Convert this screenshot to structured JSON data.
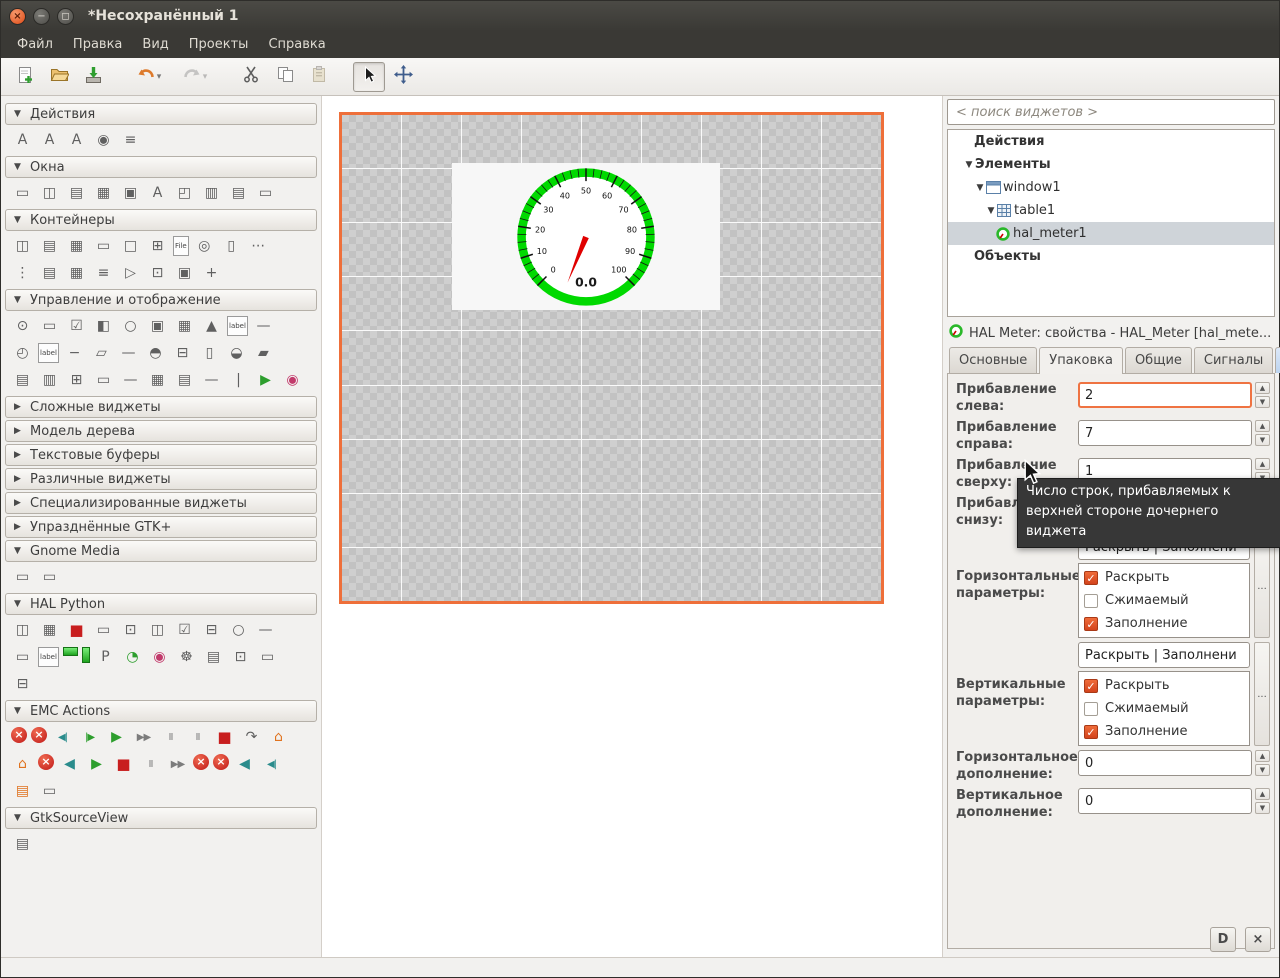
{
  "window": {
    "title": "*Несохранённый 1",
    "controls": [
      "close-button",
      "minimize-button",
      "maximize-button"
    ]
  },
  "menubar": [
    "Файл",
    "Правка",
    "Вид",
    "Проекты",
    "Справка"
  ],
  "toolbar": {
    "icons": [
      "new-file-icon",
      "open-folder-icon",
      "save-icon",
      "undo-icon",
      "redo-icon",
      "cut-icon",
      "copy-icon",
      "paste-icon",
      "pointer-icon",
      "move-resize-icon"
    ]
  },
  "palette": {
    "sections": [
      {
        "label": "Действия",
        "expanded": true,
        "rows": [
          [
            {
              "g": "A",
              "c": ""
            },
            {
              "g": "A",
              "c": ""
            },
            {
              "g": "A",
              "c": ""
            },
            {
              "g": "◉",
              "c": ""
            },
            {
              "g": "≡",
              "c": ""
            }
          ]
        ]
      },
      {
        "label": "Окна",
        "expanded": true,
        "rows": [
          [
            {
              "g": "▭",
              "c": ""
            },
            {
              "g": "◫",
              "c": ""
            },
            {
              "g": "▤",
              "c": ""
            },
            {
              "g": "▦",
              "c": ""
            },
            {
              "g": "▣",
              "c": ""
            },
            {
              "g": "A",
              "c": ""
            },
            {
              "g": "◰",
              "c": ""
            },
            {
              "g": "▥",
              "c": ""
            },
            {
              "g": "▤",
              "c": ""
            },
            {
              "g": "▭",
              "c": ""
            }
          ]
        ]
      },
      {
        "label": "Контейнеры",
        "expanded": true,
        "rows": [
          [
            {
              "g": "◫",
              "c": ""
            },
            {
              "g": "▤",
              "c": ""
            },
            {
              "g": "▦",
              "c": ""
            },
            {
              "g": "▭",
              "c": ""
            },
            {
              "g": "□",
              "c": ""
            },
            {
              "g": "⊞",
              "c": ""
            },
            {
              "g": "File",
              "c": "txt"
            },
            {
              "g": "◎",
              "c": ""
            },
            {
              "g": "▯",
              "c": ""
            },
            {
              "g": "⋯",
              "c": ""
            }
          ],
          [
            {
              "g": "⋮",
              "c": ""
            },
            {
              "g": "▤",
              "c": ""
            },
            {
              "g": "▦",
              "c": ""
            },
            {
              "g": "≡",
              "c": ""
            },
            {
              "g": "▷",
              "c": ""
            },
            {
              "g": "⊡",
              "c": ""
            },
            {
              "g": "▣",
              "c": ""
            },
            {
              "g": "+",
              "c": ""
            }
          ]
        ]
      },
      {
        "label": "Управление и отображение",
        "expanded": true,
        "rows": [
          [
            {
              "g": "⊙",
              "c": ""
            },
            {
              "g": "▭",
              "c": ""
            },
            {
              "g": "☑",
              "c": ""
            },
            {
              "g": "◧",
              "c": ""
            },
            {
              "g": "○",
              "c": ""
            },
            {
              "g": "▣",
              "c": ""
            },
            {
              "g": "▦",
              "c": ""
            },
            {
              "g": "▲",
              "c": ""
            },
            {
              "g": "label",
              "c": "txt"
            },
            {
              "g": "—",
              "c": ""
            }
          ],
          [
            {
              "g": "◴",
              "c": ""
            },
            {
              "g": "label",
              "c": "txt"
            },
            {
              "g": "−",
              "c": ""
            },
            {
              "g": "▱",
              "c": ""
            },
            {
              "g": "—",
              "c": ""
            },
            {
              "g": "◓",
              "c": ""
            },
            {
              "g": "⊟",
              "c": ""
            },
            {
              "g": "▯",
              "c": ""
            },
            {
              "g": "◒",
              "c": ""
            },
            {
              "g": "▰",
              "c": ""
            }
          ],
          [
            {
              "g": "▤",
              "c": ""
            },
            {
              "g": "▥",
              "c": ""
            },
            {
              "g": "⊞",
              "c": ""
            },
            {
              "g": "▭",
              "c": ""
            },
            {
              "g": "—",
              "c": ""
            },
            {
              "g": "▦",
              "c": ""
            },
            {
              "g": "▤",
              "c": ""
            },
            {
              "g": "—",
              "c": ""
            },
            {
              "g": "|",
              "c": ""
            },
            {
              "g": "▶",
              "c": "green"
            },
            {
              "g": "◉",
              "c": "multi"
            }
          ]
        ]
      },
      {
        "label": "Сложные виджеты",
        "expanded": false,
        "rows": []
      },
      {
        "label": "Модель дерева",
        "expanded": false,
        "rows": []
      },
      {
        "label": "Текстовые буферы",
        "expanded": false,
        "rows": []
      },
      {
        "label": "Различные виджеты",
        "expanded": false,
        "rows": []
      },
      {
        "label": "Специализированные виджеты",
        "expanded": false,
        "rows": []
      },
      {
        "label": "Упразднённые GTK+",
        "expanded": false,
        "rows": []
      },
      {
        "label": "Gnome Media",
        "expanded": true,
        "rows": [
          [
            {
              "g": "▭",
              "c": ""
            },
            {
              "g": "▭",
              "c": ""
            }
          ]
        ]
      },
      {
        "label": "HAL Python",
        "expanded": true,
        "rows": [
          [
            {
              "g": "◫",
              "c": ""
            },
            {
              "g": "▦",
              "c": ""
            },
            {
              "g": "■",
              "c": "red"
            },
            {
              "g": "▭",
              "c": ""
            },
            {
              "g": "⊡",
              "c": ""
            },
            {
              "g": "◫",
              "c": ""
            },
            {
              "g": "☑",
              "c": ""
            },
            {
              "g": "⊟",
              "c": ""
            },
            {
              "g": "○",
              "c": ""
            },
            {
              "g": "—",
              "c": ""
            }
          ],
          [
            {
              "g": "▭",
              "c": ""
            },
            {
              "g": "label",
              "c": "txt"
            },
            {
              "g": "▮",
              "c": "ledg"
            },
            {
              "g": "▮",
              "c": "ledv"
            },
            {
              "g": "P",
              "c": ""
            },
            {
              "g": "◔",
              "c": "green"
            },
            {
              "g": "◉",
              "c": "multi"
            },
            {
              "g": "☸",
              "c": ""
            },
            {
              "g": "▤",
              "c": ""
            },
            {
              "g": "⊡",
              "c": ""
            },
            {
              "g": "▭",
              "c": ""
            }
          ],
          [
            {
              "g": "⊟",
              "c": ""
            }
          ]
        ]
      },
      {
        "label": "EMC Actions",
        "expanded": true,
        "rows": [
          [
            {
              "g": "×",
              "c": "redc"
            },
            {
              "g": "×",
              "c": "redc"
            },
            {
              "g": "◀|",
              "c": "teal2"
            },
            {
              "g": "|▶",
              "c": "green2"
            },
            {
              "g": "▶",
              "c": "green"
            },
            {
              "g": "▶▶",
              "c": "gray2"
            },
            {
              "g": "II",
              "c": "gray2"
            },
            {
              "g": "II",
              "c": "gray2"
            },
            {
              "g": "■",
              "c": "red"
            },
            {
              "g": "↷",
              "c": ""
            },
            {
              "g": "⌂",
              "c": "orange"
            }
          ],
          [
            {
              "g": "⌂",
              "c": "orange"
            },
            {
              "g": "×",
              "c": "redc"
            },
            {
              "g": "◀",
              "c": "teal"
            },
            {
              "g": "▶",
              "c": "green"
            },
            {
              "g": "■",
              "c": "red"
            },
            {
              "g": "II",
              "c": "gray2"
            },
            {
              "g": "▶▶",
              "c": "gray2"
            },
            {
              "g": "×",
              "c": "redc"
            },
            {
              "g": "×",
              "c": "redc"
            },
            {
              "g": "◀",
              "c": "teal"
            },
            {
              "g": "◀|",
              "c": "teal2"
            }
          ],
          [
            {
              "g": "▤",
              "c": "orange"
            },
            {
              "g": "▭",
              "c": ""
            }
          ]
        ]
      },
      {
        "label": "GtkSourceView",
        "expanded": true,
        "rows": [
          [
            {
              "g": "▤",
              "c": ""
            }
          ]
        ]
      }
    ]
  },
  "canvas": {
    "grid": {
      "cols": 9,
      "rows": 9
    },
    "gauge": {
      "value": "0.0",
      "min": 0,
      "max": 100,
      "tick_labels": [
        "0",
        "10",
        "20",
        "30",
        "40",
        "50",
        "60",
        "70",
        "80",
        "90",
        "100"
      ]
    }
  },
  "inspector": {
    "search_placeholder": "< поиск виджетов >",
    "tree": [
      {
        "label": "Действия",
        "bold": true,
        "indent": 2,
        "expander": "",
        "icon": "",
        "selected": false
      },
      {
        "label": "Элементы",
        "bold": true,
        "indent": 1,
        "expander": "▼",
        "icon": "",
        "selected": false
      },
      {
        "label": "window1",
        "bold": false,
        "indent": 2,
        "expander": "▼",
        "icon": "window-icon",
        "selected": false
      },
      {
        "label": "table1",
        "bold": false,
        "indent": 3,
        "expander": "▼",
        "icon": "table-icon",
        "selected": false
      },
      {
        "label": "hal_meter1",
        "bold": false,
        "indent": 4,
        "expander": "",
        "icon": "meter-icon",
        "selected": true
      },
      {
        "label": "Объекты",
        "bold": true,
        "indent": 2,
        "expander": "",
        "icon": "",
        "selected": false
      }
    ]
  },
  "properties": {
    "header": "HAL Meter: свойства - HAL_Meter [hal_mete...",
    "tabs": [
      "Основные",
      "Упаковка",
      "Общие",
      "Сигналы"
    ],
    "active_tab": "Упаковка",
    "a11y_tab_icon": "♿",
    "spin_fields": [
      {
        "label": "Прибавление слева:",
        "value": "2",
        "focused": true
      },
      {
        "label": "Прибавление справа:",
        "value": "7",
        "focused": false
      },
      {
        "label": "Прибавление сверху:",
        "value": "1",
        "focused": false
      },
      {
        "label": "Прибавление снизу:",
        "value": "",
        "focused": false
      }
    ],
    "param_groups": [
      {
        "label": "Горизонтальные параметры:",
        "summary": "Раскрыть | Заполнени",
        "options": [
          {
            "label": "Раскрыть",
            "checked": true
          },
          {
            "label": "Сжимаемый",
            "checked": false
          },
          {
            "label": "Заполнение",
            "checked": true
          }
        ]
      },
      {
        "label": "Вертикальные параметры:",
        "summary": "Раскрыть | Заполнени",
        "options": [
          {
            "label": "Раскрыть",
            "checked": true
          },
          {
            "label": "Сжимаемый",
            "checked": false
          },
          {
            "label": "Заполнение",
            "checked": true
          }
        ]
      }
    ],
    "padding_fields": [
      {
        "label": "Горизонтальное дополнение:",
        "value": "0"
      },
      {
        "label": "Вертикальное дополнение:",
        "value": "0"
      }
    ],
    "ellipsis": "..."
  },
  "tooltip": {
    "text": "Число строк, прибавляемых к верхней стороне дочернего виджета"
  },
  "statusbar_buttons": [
    {
      "glyph": "D"
    },
    {
      "glyph": "×"
    }
  ],
  "colors": {
    "selection_orange": "#ee6f3a",
    "focus_orange": "#ef7342",
    "gauge_green": "#00d900",
    "needle_red": "#e00000",
    "check_orange": "#d3431c"
  }
}
